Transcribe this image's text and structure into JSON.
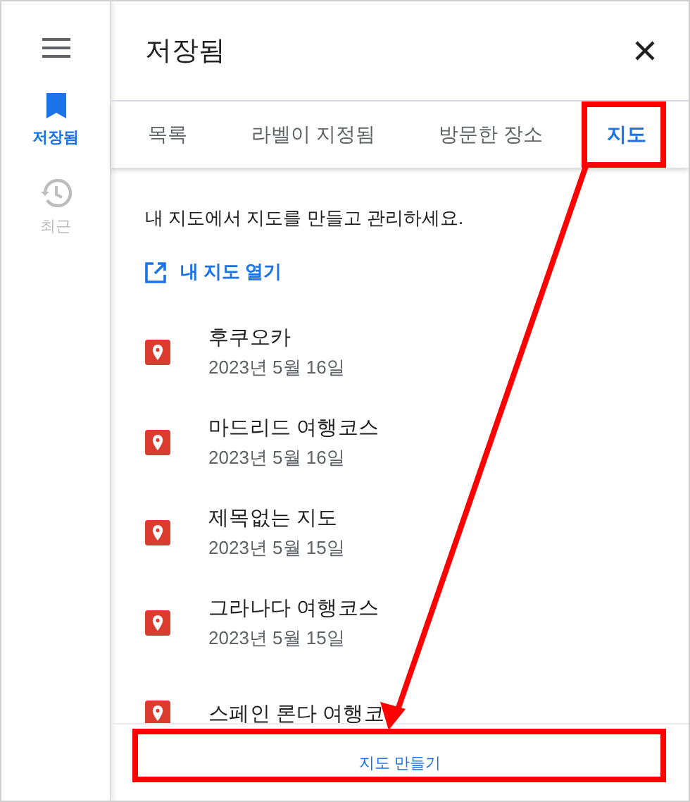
{
  "rail": {
    "items": [
      {
        "kind": "menu"
      },
      {
        "kind": "saved",
        "label": "저장됨",
        "selected": true
      },
      {
        "kind": "recent",
        "label": "최근",
        "selected": false
      }
    ]
  },
  "panel": {
    "title": "저장됨"
  },
  "tabs": [
    {
      "label": "목록",
      "selected": false
    },
    {
      "label": "라벨이 지정됨",
      "selected": false
    },
    {
      "label": "방문한 장소",
      "selected": false
    },
    {
      "label": "지도",
      "selected": true
    }
  ],
  "description": "내 지도에서 지도를 만들고 관리하세요.",
  "open_link": "내 지도 열기",
  "maps": [
    {
      "name": "후쿠오카",
      "date": "2023년 5월 16일"
    },
    {
      "name": "마드리드 여행코스",
      "date": "2023년 5월 16일"
    },
    {
      "name": "제목없는 지도",
      "date": "2023년 5월 15일"
    },
    {
      "name": "그라나다 여행코스",
      "date": "2023년 5월 15일"
    },
    {
      "name": "스페인 론다 여행코"
    }
  ],
  "create_button": "지도 만들기",
  "annotations": [
    {
      "kind": "tab-highlight"
    },
    {
      "kind": "button-highlight"
    },
    {
      "kind": "arrow"
    }
  ]
}
